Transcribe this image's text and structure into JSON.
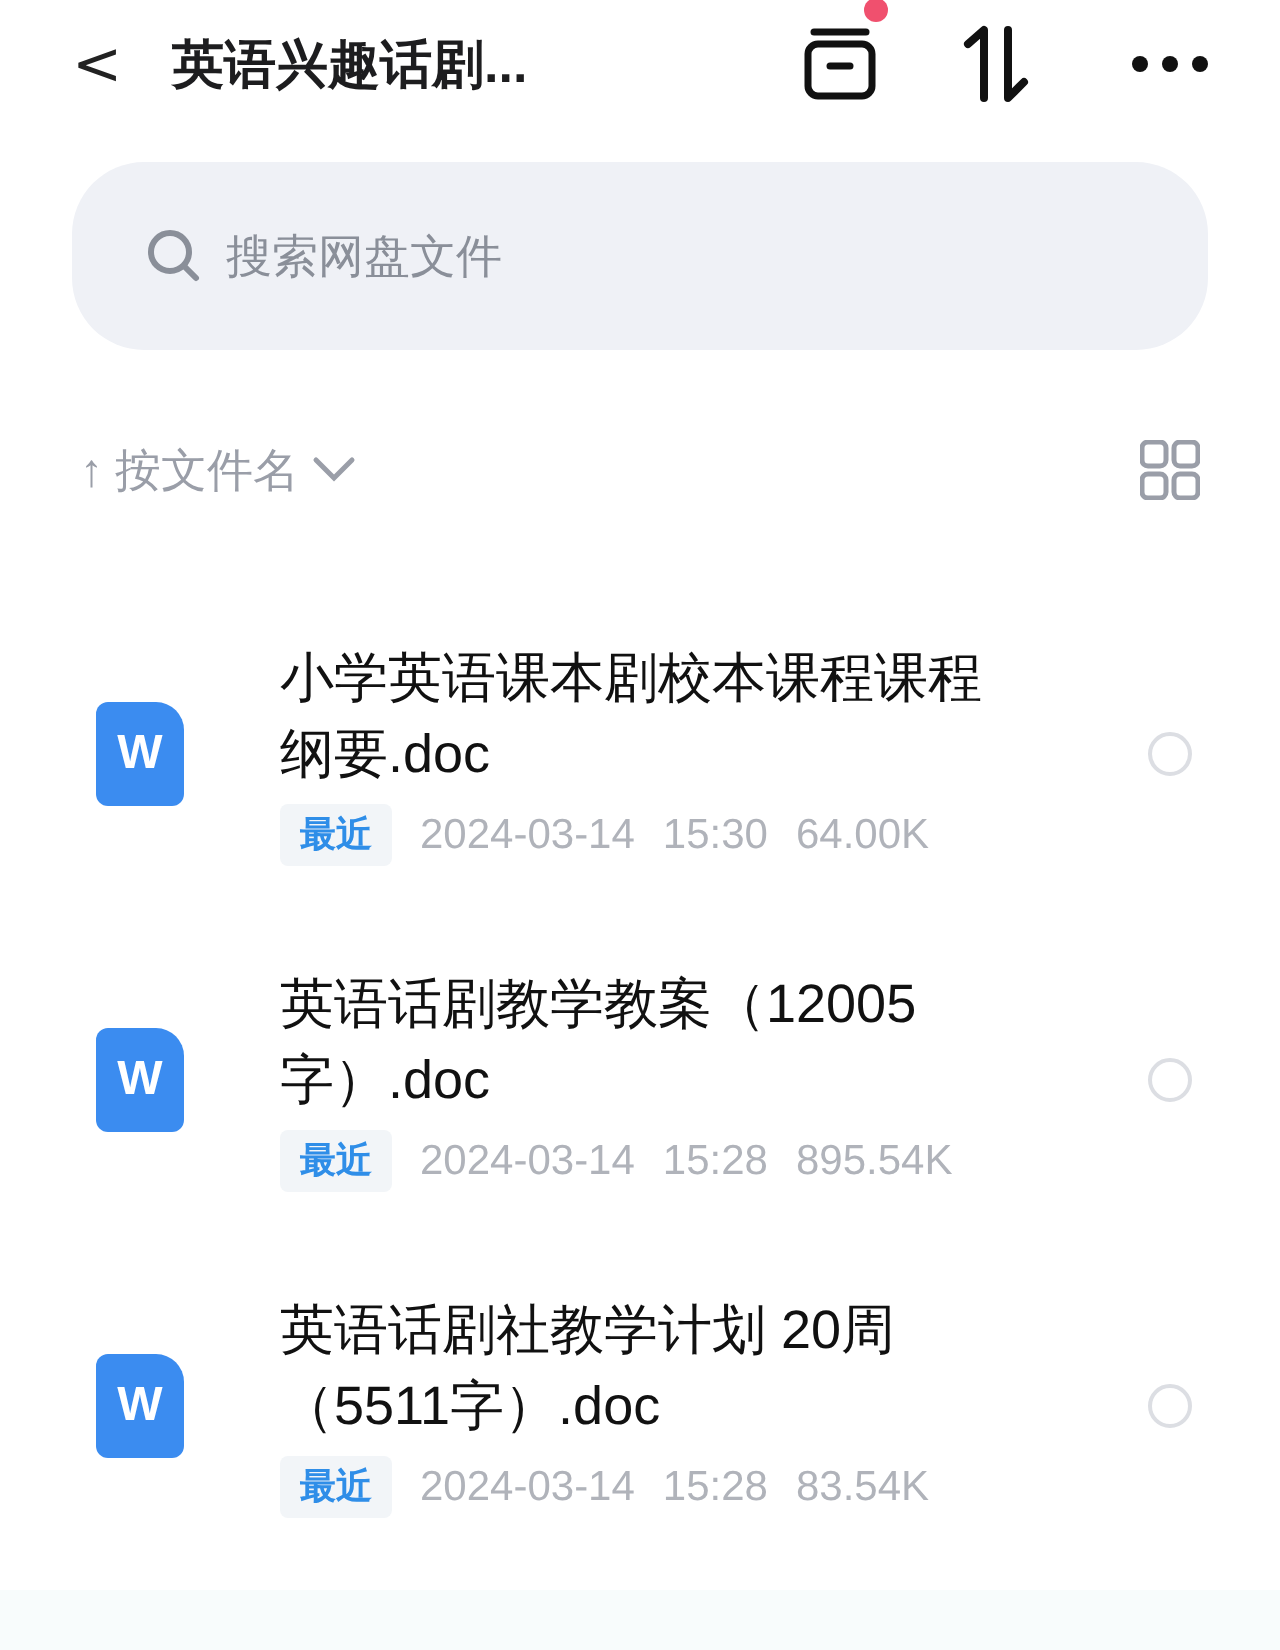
{
  "header": {
    "back": "<",
    "title": "英语兴趣话剧...",
    "notification_dot": true
  },
  "search": {
    "placeholder": "搜索网盘文件"
  },
  "sort": {
    "arrow": "↑",
    "label": "按文件名"
  },
  "files": [
    {
      "kind": "doc",
      "icon_label": "W",
      "name": "小学英语课本剧校本课程课程纲要.doc",
      "badge": "最近",
      "date": "2024-03-14",
      "time": "15:30",
      "size": "64.00K",
      "selected": false
    },
    {
      "kind": "doc",
      "icon_label": "W",
      "name": "英语话剧教学教案（12005字）.doc",
      "badge": "最近",
      "date": "2024-03-14",
      "time": "15:28",
      "size": "895.54K",
      "selected": false
    },
    {
      "kind": "doc",
      "icon_label": "W",
      "name": "英语话剧社教学计划 20周（5511字）.doc",
      "badge": "最近",
      "date": "2024-03-14",
      "time": "15:28",
      "size": "83.54K",
      "selected": false
    }
  ]
}
